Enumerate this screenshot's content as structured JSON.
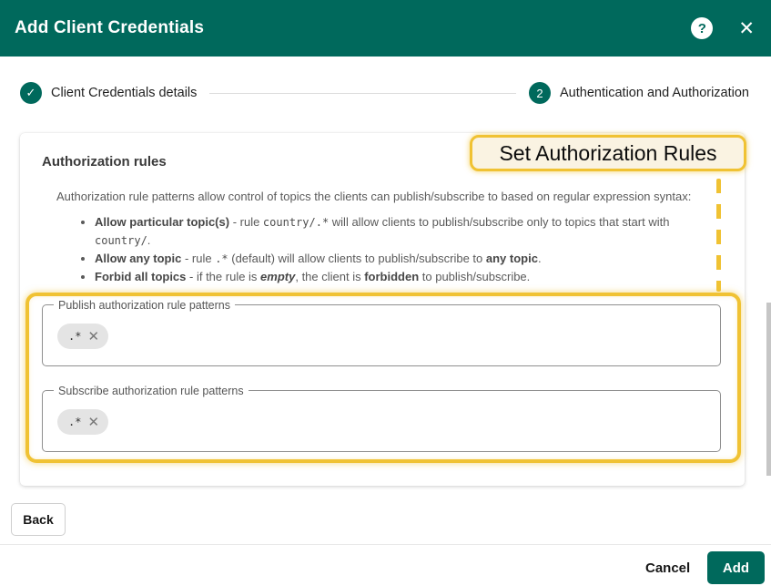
{
  "colors": {
    "accent_teal": "#00695C",
    "annotation_gold": "#F0C233",
    "annotation_bg": "#FAF3E2"
  },
  "header": {
    "title": "Add Client Credentials",
    "icons": {
      "help": "?",
      "close": "✕"
    }
  },
  "stepper": {
    "steps": [
      {
        "indicator": "✓",
        "label": "Client Credentials details",
        "state": "completed"
      },
      {
        "indicator": "2",
        "label": "Authentication and Authorization",
        "state": "active"
      }
    ]
  },
  "annotation": {
    "tooltip": "Set Authorization Rules"
  },
  "card": {
    "heading": "Authorization rules",
    "intro": "Authorization rule patterns allow control of topics the clients can publish/subscribe to based on regular expression syntax:",
    "bullets": [
      {
        "segments": [
          {
            "t": "Allow particular topic(s)",
            "s": "bold"
          },
          {
            "t": " - rule ",
            "s": "plain"
          },
          {
            "t": "country/.*",
            "s": "mono"
          },
          {
            "t": " will allow clients to publish/subscribe only to topics that start with ",
            "s": "plain"
          },
          {
            "t": "country/",
            "s": "mono"
          },
          {
            "t": ".",
            "s": "plain"
          }
        ]
      },
      {
        "segments": [
          {
            "t": "Allow any topic",
            "s": "bold"
          },
          {
            "t": " - rule ",
            "s": "plain"
          },
          {
            "t": ".*",
            "s": "mono"
          },
          {
            "t": " (default) will allow clients to publish/subscribe to ",
            "s": "plain"
          },
          {
            "t": "any topic",
            "s": "bold"
          },
          {
            "t": ".",
            "s": "plain"
          }
        ]
      },
      {
        "segments": [
          {
            "t": "Forbid all topics",
            "s": "bold"
          },
          {
            "t": " - if the rule is ",
            "s": "plain"
          },
          {
            "t": "empty",
            "s": "bolditalic"
          },
          {
            "t": ", the client is ",
            "s": "plain"
          },
          {
            "t": "forbidden",
            "s": "bold"
          },
          {
            "t": " to publish/subscribe.",
            "s": "plain"
          }
        ]
      }
    ]
  },
  "fields": [
    {
      "label": "Publish authorization rule patterns",
      "chips": [
        {
          "value": ".*",
          "remove_icon": "✕"
        }
      ]
    },
    {
      "label": "Subscribe authorization rule patterns",
      "chips": [
        {
          "value": ".*",
          "remove_icon": "✕"
        }
      ]
    }
  ],
  "buttons": {
    "back": "Back",
    "cancel": "Cancel",
    "add": "Add"
  }
}
